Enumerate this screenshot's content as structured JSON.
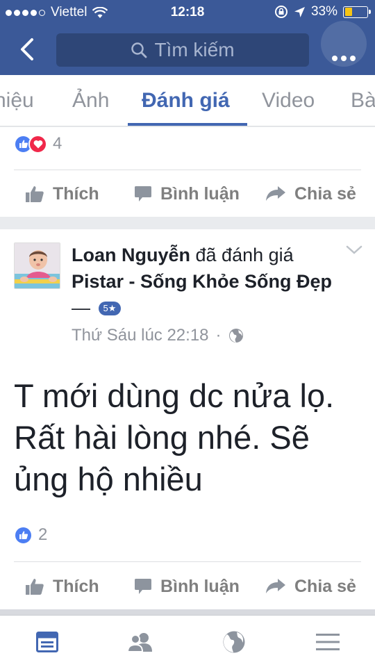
{
  "status_bar": {
    "carrier": "Viettel",
    "time": "12:18",
    "battery": "33%",
    "battery_level": 0.33
  },
  "header": {
    "search_placeholder": "Tìm kiếm"
  },
  "tabs": [
    {
      "label": "hiệu",
      "active": false
    },
    {
      "label": "Ảnh",
      "active": false
    },
    {
      "label": "Đánh giá",
      "active": true
    },
    {
      "label": "Video",
      "active": false
    },
    {
      "label": "Bà",
      "active": false
    }
  ],
  "top_card": {
    "reaction_count": "4",
    "actions": {
      "like": "Thích",
      "comment": "Bình luận",
      "share": "Chia sẻ"
    }
  },
  "review_post": {
    "author": "Loan Nguyễn",
    "verb": " đã đánh giá ",
    "page": "Pistar - Sống Khỏe Sống Đẹp",
    "dash": " —",
    "rating": "5★",
    "time": "Thứ Sáu lúc 22:18",
    "time_separator": "·",
    "body": "T mới dùng dc nửa lọ. Rất hài lòng nhé. Sẽ ủng hộ nhiều",
    "reaction_count": "2",
    "actions": {
      "like": "Thích",
      "comment": "Bình luận",
      "share": "Chia sẻ"
    }
  },
  "bottom_nav": [
    {
      "icon": "news-feed-icon",
      "active": true
    },
    {
      "icon": "friends-icon",
      "active": false
    },
    {
      "icon": "globe-icon",
      "active": false
    },
    {
      "icon": "menu-icon",
      "active": false
    }
  ],
  "colors": {
    "brand": "#3b5998",
    "accent": "#4267b2",
    "like_blue": "#4c7ef3",
    "love_red": "#f0284a"
  }
}
